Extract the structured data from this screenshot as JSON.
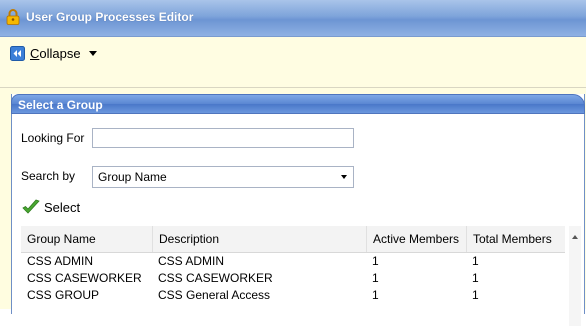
{
  "window": {
    "title": "User Group Processes Editor"
  },
  "toolbar": {
    "collapse_label_underlined": "C",
    "collapse_label_rest": "ollapse"
  },
  "panel": {
    "title": "Select a Group",
    "looking_for_label": "Looking For",
    "looking_for_value": "",
    "search_by_label": "Search by",
    "search_by_value": "Group Name",
    "select_label": "Select"
  },
  "grid": {
    "columns": [
      "Group Name",
      "Description",
      "Active Members",
      "Total Members"
    ],
    "rows": [
      [
        "CSS ADMIN",
        "CSS ADMIN",
        "1",
        "1"
      ],
      [
        "CSS CASEWORKER",
        "CSS CASEWORKER",
        "1",
        "1"
      ],
      [
        "CSS GROUP",
        "CSS General Access",
        "1",
        "1"
      ]
    ]
  },
  "colors": {
    "titlebar": "#7ea4da",
    "toolbar_bg": "#fffde2",
    "panel_header": "#5a86d2",
    "accent_green": "#4aa832"
  }
}
